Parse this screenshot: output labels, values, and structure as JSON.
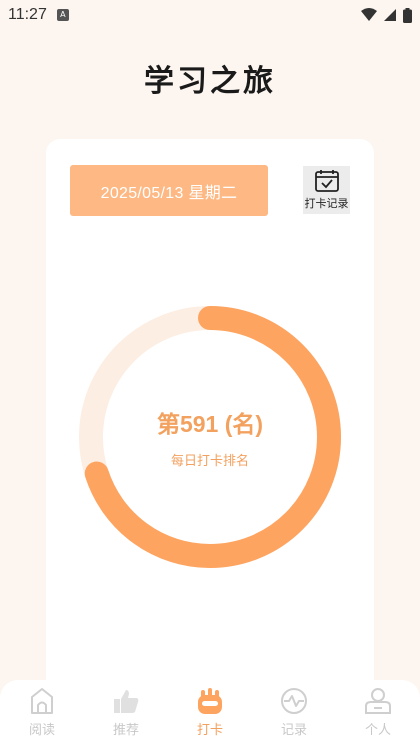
{
  "status_bar": {
    "time": "11:27",
    "app_icon": "A"
  },
  "page": {
    "title": "学习之旅"
  },
  "date_box": {
    "text": "2025/05/13  星期二"
  },
  "checkin_record": {
    "label": "打卡记录",
    "icon": "calendar-check-icon"
  },
  "ranking": {
    "text": "第591 (名)",
    "subtitle": "每日打卡排名",
    "progress_fraction": 0.7
  },
  "colors": {
    "accent": "#fda460",
    "accent_light": "#fdb883",
    "ring_track": "#fdeee3"
  },
  "tabs": [
    {
      "label": "阅读",
      "icon": "house-icon",
      "active": false
    },
    {
      "label": "推荐",
      "icon": "thumbs-up-icon",
      "active": false
    },
    {
      "label": "打卡",
      "icon": "paw-icon",
      "active": true
    },
    {
      "label": "记录",
      "icon": "pulse-icon",
      "active": false
    },
    {
      "label": "个人",
      "icon": "person-icon",
      "active": false
    }
  ]
}
